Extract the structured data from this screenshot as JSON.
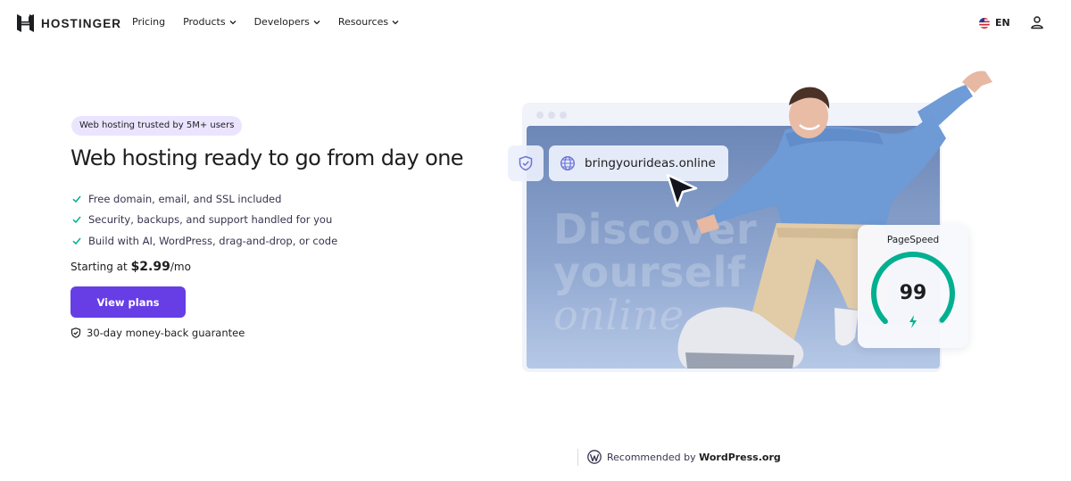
{
  "brand": {
    "name": "HOSTINGER"
  },
  "nav": {
    "items": [
      {
        "label": "Pricing",
        "has_dropdown": false
      },
      {
        "label": "Products",
        "has_dropdown": true
      },
      {
        "label": "Developers",
        "has_dropdown": true
      },
      {
        "label": "Resources",
        "has_dropdown": true
      }
    ],
    "language": "EN",
    "icons": {
      "flag": "us-flag-icon",
      "account": "user-icon",
      "dropdown": "chevron-down-icon"
    }
  },
  "hero": {
    "badge": "Web hosting trusted by 5M+ users",
    "headline": "Web hosting ready to go from day one",
    "features": [
      "Free domain, email, and SSL included",
      "Security, backups, and support handled for you",
      "Build with AI, WordPress, drag-and-drop, or code"
    ],
    "price_prefix": "Starting at ",
    "price_amount": "$2.99",
    "price_suffix": "/mo",
    "cta_label": "View plans",
    "guarantee": "30-day money-back guarantee"
  },
  "visual": {
    "url": "bringyourideas.online",
    "background_text": [
      "Discover",
      "yourself",
      "online"
    ],
    "pagespeed_label": "PageSpeed",
    "pagespeed_score": 99,
    "pagespeed_max": 100
  },
  "footer": {
    "recommended_prefix": "Recommended by ",
    "recommended_brand": "WordPress.org"
  },
  "colors": {
    "accent": "#673de6",
    "badge_bg": "#ebe4ff",
    "gauge": "#00b090",
    "text": "#1d1e20"
  }
}
